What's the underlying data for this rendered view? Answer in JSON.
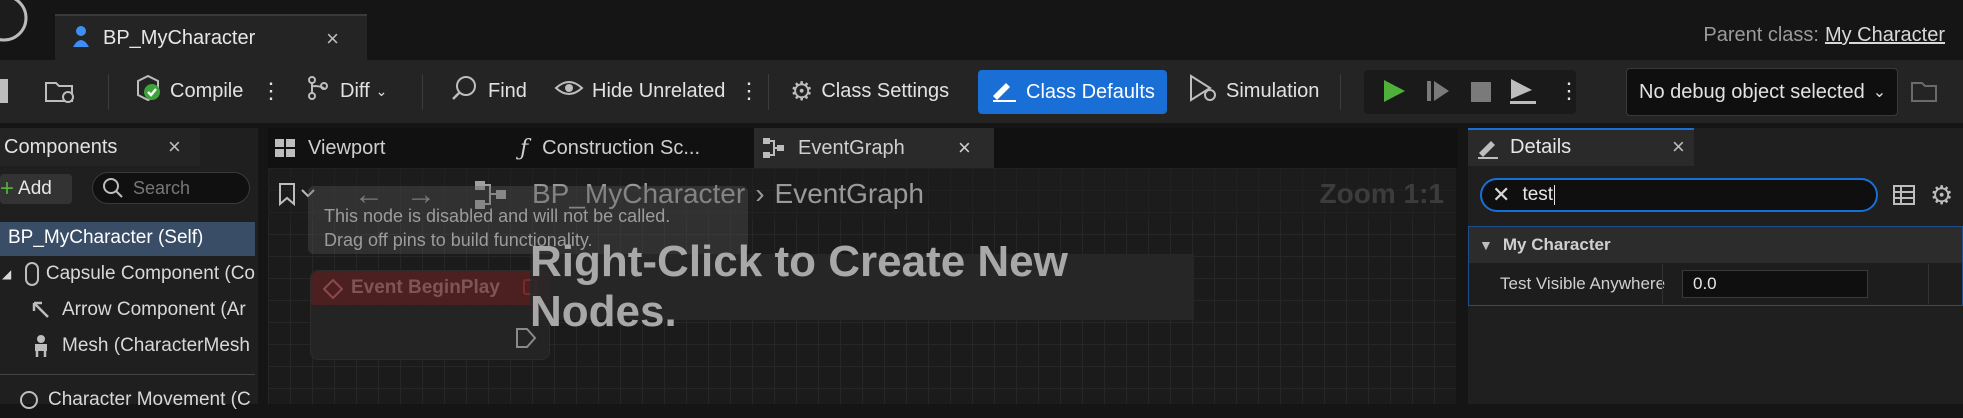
{
  "document_tab": {
    "label": "BP_MyCharacter",
    "close": "×"
  },
  "parent_class": {
    "label": "Parent class:",
    "value": "My Character"
  },
  "toolbar": {
    "compile": "Compile",
    "diff": "Diff",
    "find": "Find",
    "hide_unrelated": "Hide Unrelated",
    "class_settings": "Class Settings",
    "class_defaults": "Class Defaults",
    "simulation": "Simulation",
    "debug_object": "No debug object selected"
  },
  "components_panel": {
    "title": "Components",
    "close": "×",
    "add": "Add",
    "search_placeholder": "Search",
    "items": [
      {
        "label": "BP_MyCharacter (Self)"
      },
      {
        "label": "Capsule Component (Co"
      },
      {
        "label": "Arrow Component (Ar"
      },
      {
        "label": "Mesh (CharacterMesh"
      },
      {
        "label": "Character Movement (C"
      }
    ]
  },
  "graph_tabs": {
    "viewport": "Viewport",
    "construction": "Construction Sc...",
    "eventgraph": "EventGraph",
    "close": "×"
  },
  "graph": {
    "breadcrumb_root": "BP_MyCharacter",
    "breadcrumb_sep": "›",
    "breadcrumb_current": "EventGraph",
    "zoom": "Zoom 1:1",
    "disabled_note_line1": "This node is disabled and will not be called.",
    "disabled_note_line2": "Drag off pins to build functionality.",
    "node_title": "Event BeginPlay",
    "hint": "Right-Click to Create New Nodes."
  },
  "details_panel": {
    "title": "Details",
    "close": "×",
    "search_value": "test",
    "category": "My Character",
    "property_name": "Test Visible Anywhere",
    "property_value": "0.0"
  },
  "colors": {
    "accent": "#1a6fd6",
    "play_green": "#4fb03c"
  }
}
